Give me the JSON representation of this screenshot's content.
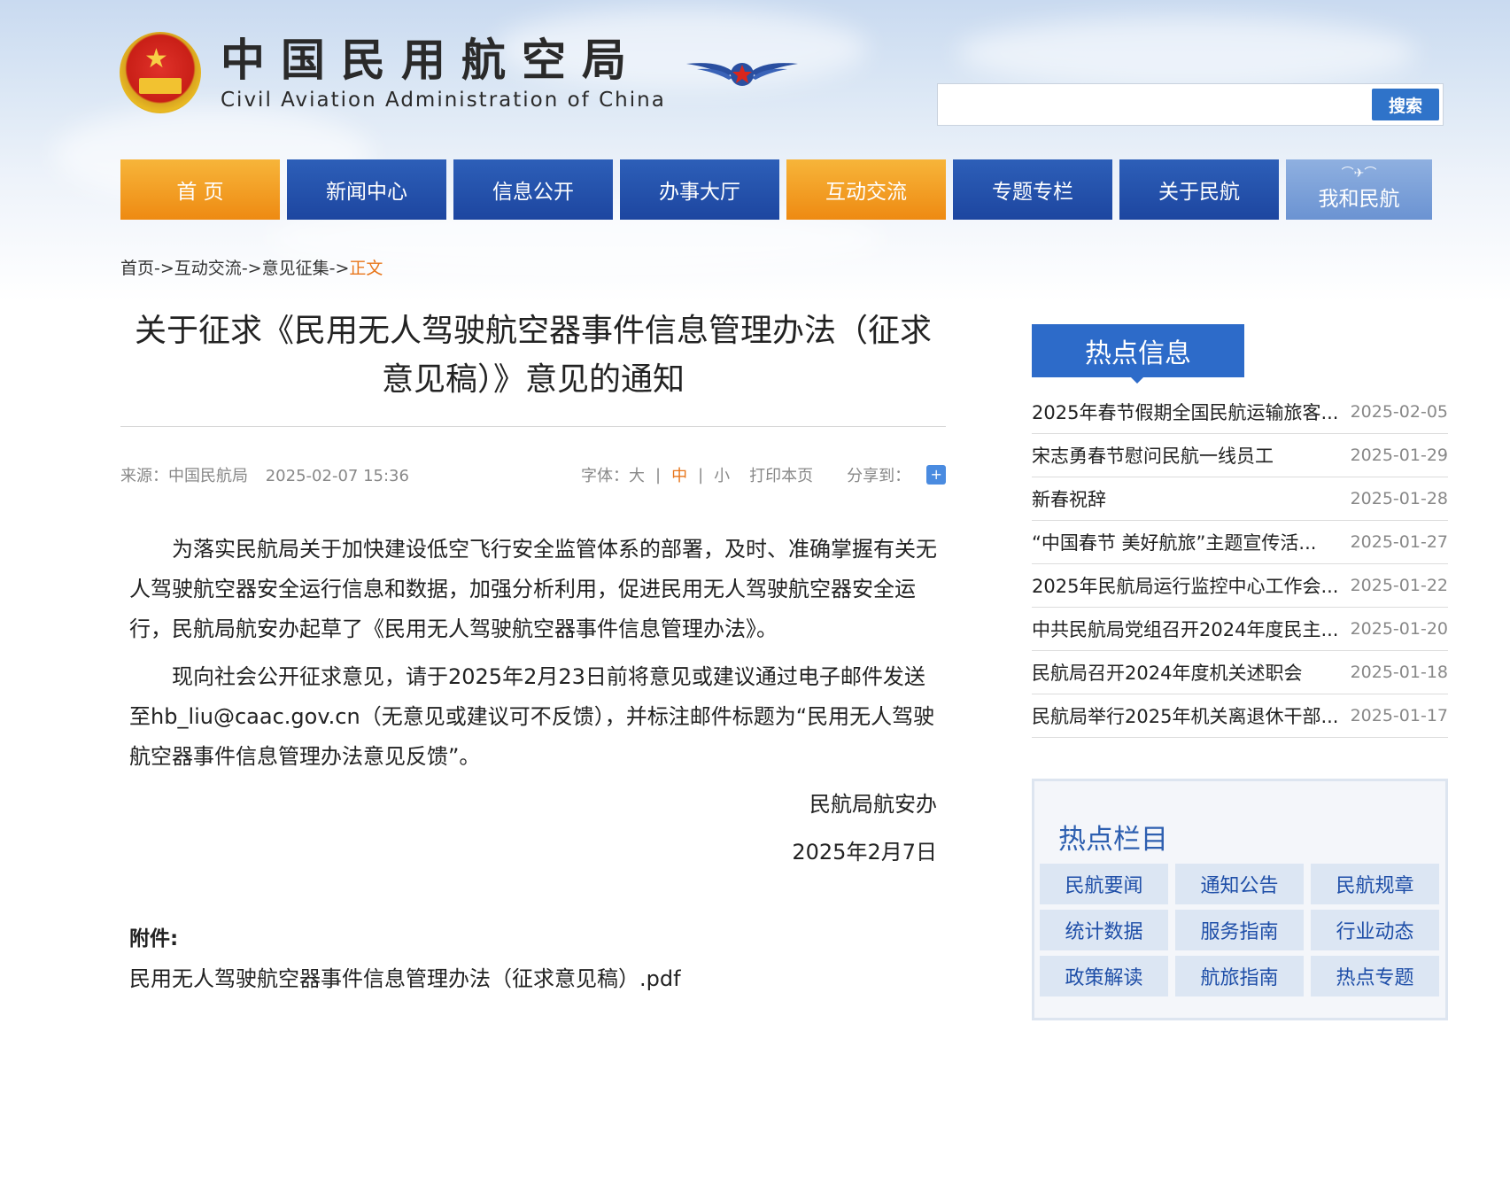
{
  "header": {
    "logo_cn": "中国民用航空局",
    "logo_en": "Civil Aviation Administration of China",
    "search_placeholder": "",
    "search_button": "搜索"
  },
  "nav": {
    "items": [
      {
        "label": "首 页",
        "style": "orange"
      },
      {
        "label": "新闻中心",
        "style": "blue"
      },
      {
        "label": "信息公开",
        "style": "blue"
      },
      {
        "label": "办事大厅",
        "style": "blue"
      },
      {
        "label": "互动交流",
        "style": "orange"
      },
      {
        "label": "专题专栏",
        "style": "blue"
      },
      {
        "label": "关于民航",
        "style": "blue"
      },
      {
        "label": "我和民航",
        "style": "light"
      }
    ]
  },
  "breadcrumb": {
    "items": [
      "首页",
      "互动交流",
      "意见征集"
    ],
    "separator": "->",
    "current": "正文"
  },
  "article": {
    "title_line1": "关于征求《民用无人驾驶航空器事件信息管理办法（征求",
    "title_line2": "意见稿）》意见的通知",
    "source": "来源：中国民航局",
    "datetime": "2025-02-07 15:36",
    "font_label": "字体：",
    "font_large": "大",
    "font_medium": "中",
    "font_small": "小",
    "print": "打印本页",
    "share": "分享到：",
    "paragraph1": "为落实民航局关于加快建设低空飞行安全监管体系的部署，及时、准确掌握有关无人驾驶航空器安全运行信息和数据，加强分析利用，促进民用无人驾驶航空器安全运行，民航局航安办起草了《民用无人驾驶航空器事件信息管理办法》。",
    "paragraph2": "现向社会公开征求意见，请于2025年2月23日前将意见或建议通过电子邮件发送至hb_liu@caac.gov.cn（无意见或建议可不反馈），并标注邮件标题为“民用无人驾驶航空器事件信息管理办法意见反馈”。",
    "signature_org": "民航局航安办",
    "signature_date": "2025年2月7日",
    "attachment_label": "附件:",
    "attachment_file": "民用无人驾驶航空器事件信息管理办法（征求意见稿）.pdf"
  },
  "hot_info": {
    "title": "热点信息",
    "items": [
      {
        "title": "2025年春节假期全国民航运输旅客...",
        "date": "2025-02-05"
      },
      {
        "title": "宋志勇春节慰问民航一线员工",
        "date": "2025-01-29"
      },
      {
        "title": "新春祝辞",
        "date": "2025-01-28"
      },
      {
        "title": "“中国春节 美好航旅”主题宣传活...",
        "date": "2025-01-27"
      },
      {
        "title": "2025年民航局运行监控中心工作会...",
        "date": "2025-01-22"
      },
      {
        "title": "中共民航局党组召开2024年度民主...",
        "date": "2025-01-20"
      },
      {
        "title": "民航局召开2024年度机关述职会",
        "date": "2025-01-18"
      },
      {
        "title": "民航局举行2025年机关离退休干部...",
        "date": "2025-01-17"
      }
    ]
  },
  "hot_topics": {
    "title": "热点栏目",
    "items": [
      "民航要闻",
      "通知公告",
      "民航规章",
      "统计数据",
      "服务指南",
      "行业动态",
      "政策解读",
      "航旅指南",
      "热点专题"
    ]
  },
  "colors": {
    "nav_blue": "#1d46a0",
    "nav_orange": "#ee8a12",
    "accent_orange": "#e8761b",
    "hot_blue": "#2d6bc9"
  }
}
